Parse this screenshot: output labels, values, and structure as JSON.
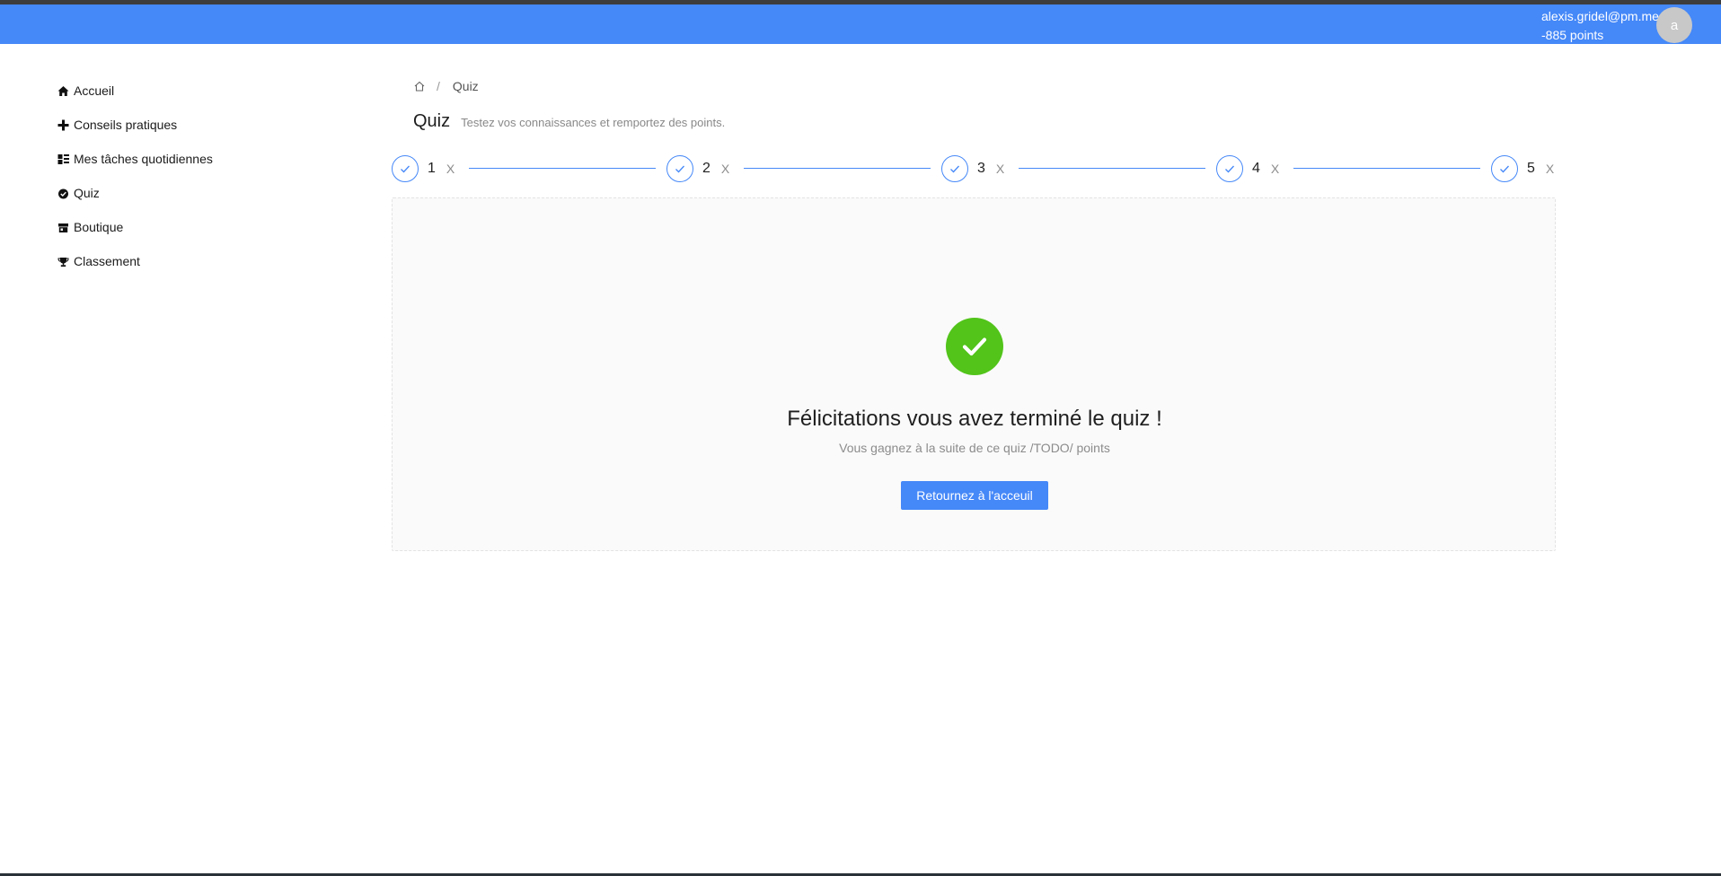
{
  "header": {
    "user_email": "alexis.gridel@pm.me",
    "user_points": "-885 points",
    "avatar_initial": "a",
    "accent_color": "#4588f8"
  },
  "sidebar": {
    "items": [
      {
        "label": "Accueil",
        "icon": "home-icon"
      },
      {
        "label": "Conseils pratiques",
        "icon": "plus-icon"
      },
      {
        "label": "Mes tâches quotidiennes",
        "icon": "tasks-icon"
      },
      {
        "label": "Quiz",
        "icon": "check-circle-icon"
      },
      {
        "label": "Boutique",
        "icon": "shop-icon"
      },
      {
        "label": "Classement",
        "icon": "trophy-icon"
      }
    ]
  },
  "breadcrumb": {
    "separator": "/",
    "current": "Quiz"
  },
  "page": {
    "title": "Quiz",
    "subtitle": "Testez vos connaissances et remportez des points."
  },
  "steps": [
    {
      "number": "1",
      "mark": "X"
    },
    {
      "number": "2",
      "mark": "X"
    },
    {
      "number": "3",
      "mark": "X"
    },
    {
      "number": "4",
      "mark": "X"
    },
    {
      "number": "5",
      "mark": "X"
    }
  ],
  "result": {
    "title": "Félicitations vous avez terminé le quiz !",
    "subtitle": "Vous gagnez à la suite de ce quiz /TODO/ points",
    "button_label": "Retournez à l'acceuil",
    "success_color": "#52c41a"
  }
}
